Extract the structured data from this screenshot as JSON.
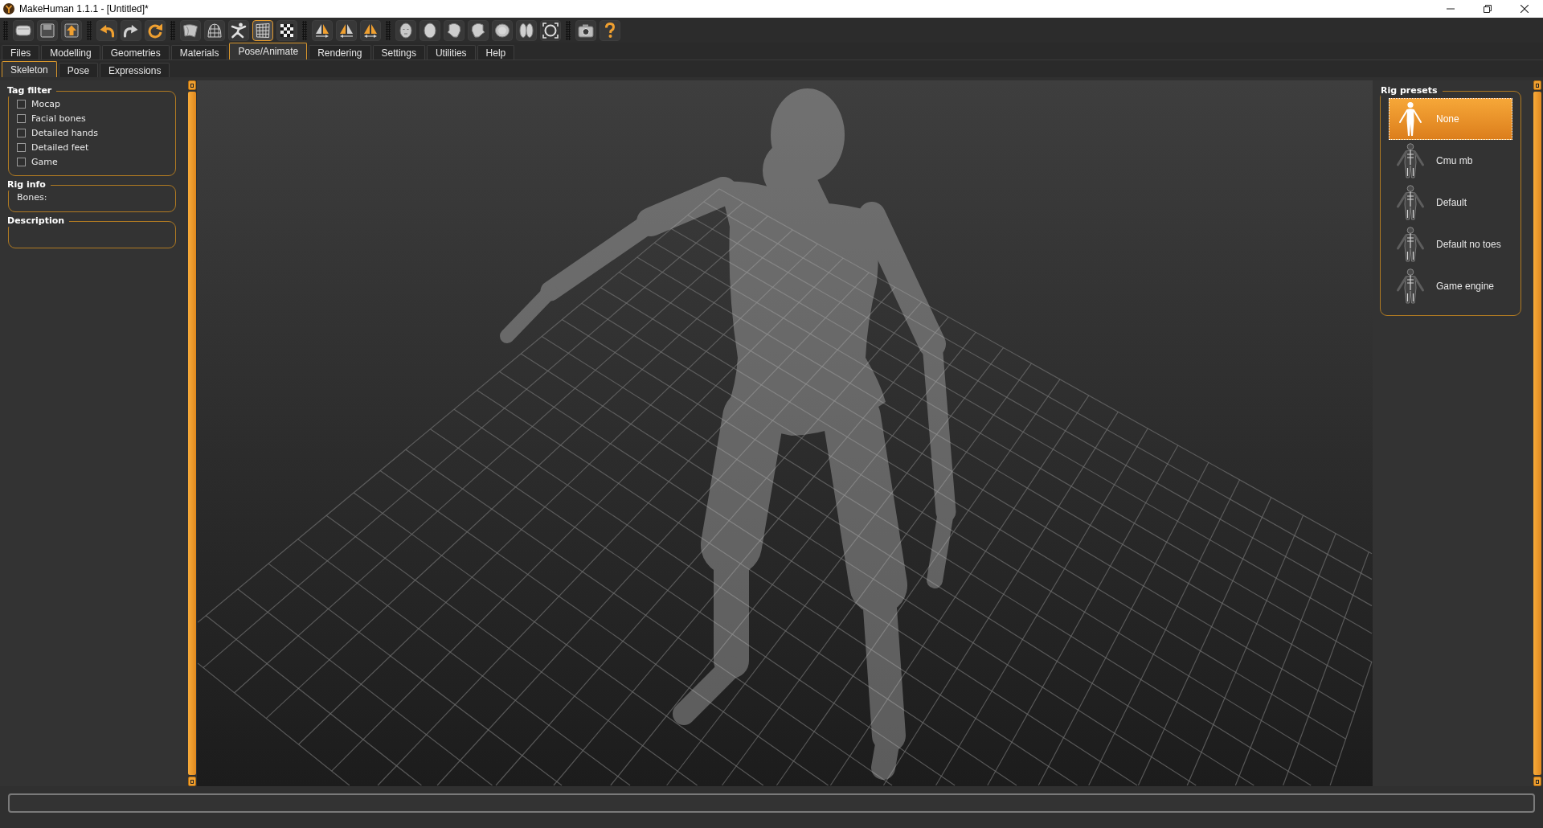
{
  "window": {
    "title": "MakeHuman 1.1.1 - [Untitled]*"
  },
  "toolbar": [
    {
      "buttons": [
        {
          "on": false
        },
        {
          "on": false
        },
        {
          "on": false
        }
      ]
    },
    {
      "buttons": [
        {
          "on": false
        },
        {
          "on": false
        },
        {
          "on": false
        }
      ]
    },
    {
      "buttons": [
        {
          "on": false
        },
        {
          "on": false
        },
        {
          "on": false
        },
        {
          "on": true
        },
        {
          "on": false
        }
      ]
    },
    {
      "buttons": [
        {
          "on": false
        },
        {
          "on": false
        },
        {
          "on": false
        }
      ]
    },
    {
      "buttons": [
        {
          "on": false
        },
        {
          "on": false
        },
        {
          "on": false
        },
        {
          "on": false
        },
        {
          "on": false
        },
        {
          "on": false
        },
        {
          "on": false
        }
      ]
    },
    {
      "buttons": [
        {
          "on": false
        },
        {
          "on": false
        }
      ]
    }
  ],
  "tabs": [
    {
      "label": "Files",
      "selected": false
    },
    {
      "label": "Modelling",
      "selected": false
    },
    {
      "label": "Geometries",
      "selected": false
    },
    {
      "label": "Materials",
      "selected": false
    },
    {
      "label": "Pose/Animate",
      "selected": true
    },
    {
      "label": "Rendering",
      "selected": false
    },
    {
      "label": "Settings",
      "selected": false
    },
    {
      "label": "Utilities",
      "selected": false
    },
    {
      "label": "Help",
      "selected": false
    }
  ],
  "subtabs": [
    {
      "label": "Skeleton",
      "selected": true
    },
    {
      "label": "Pose",
      "selected": false
    },
    {
      "label": "Expressions",
      "selected": false
    }
  ],
  "left_panel": {
    "tag_filter": {
      "title": "Tag filter",
      "options": [
        {
          "label": "Mocap",
          "checked": false
        },
        {
          "label": "Facial bones",
          "checked": false
        },
        {
          "label": "Detailed hands",
          "checked": false
        },
        {
          "label": "Detailed feet",
          "checked": false
        },
        {
          "label": "Game",
          "checked": false
        }
      ]
    },
    "rig_info": {
      "title": "Rig info",
      "bones_label": "Bones:"
    },
    "description": {
      "title": "Description"
    }
  },
  "right_panel": {
    "rig_presets": {
      "title": "Rig presets",
      "items": [
        {
          "label": "None",
          "kind": "silhouette",
          "selected": true
        },
        {
          "label": "Cmu mb",
          "kind": "skeleton",
          "selected": false
        },
        {
          "label": "Default",
          "kind": "skeleton",
          "selected": false
        },
        {
          "label": "Default no toes",
          "kind": "skeleton",
          "selected": false
        },
        {
          "label": "Game engine",
          "kind": "skeleton",
          "selected": false
        }
      ]
    }
  }
}
